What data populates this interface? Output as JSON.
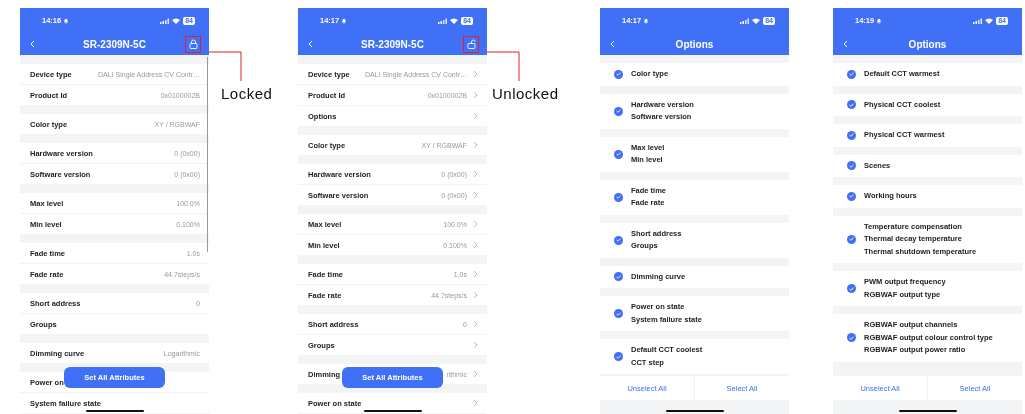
{
  "screens": [
    {
      "kind": "details",
      "time": "14:16",
      "battery": "84",
      "title": "SR-2309N-5C",
      "locked": true,
      "editable": false,
      "scrolling": true,
      "callout": "Locked",
      "sections": [
        [
          {
            "label": "Device type",
            "value": "DALI Single Address CV Contr…"
          },
          {
            "label": "Product Id",
            "value": "0x0100002B"
          }
        ],
        [
          {
            "label": "Color type",
            "value": "XY / RGBWAF"
          }
        ],
        [
          {
            "label": "Hardware version",
            "value": "0 (0x00)"
          },
          {
            "label": "Software version",
            "value": "0 (0x00)"
          }
        ],
        [
          {
            "label": "Max level",
            "value": "100.0%"
          },
          {
            "label": "Min level",
            "value": "0.100%"
          }
        ],
        [
          {
            "label": "Fade time",
            "value": "1.0s"
          },
          {
            "label": "Fade rate",
            "value": "44.7steps/s"
          }
        ],
        [
          {
            "label": "Short address",
            "value": "0"
          },
          {
            "label": "Groups"
          }
        ],
        [
          {
            "label": "Dimming curve",
            "value": "Logarithmic"
          }
        ],
        [
          {
            "label": "Power on"
          },
          {
            "label": "System failure state"
          }
        ]
      ],
      "action_button": "Set All Attributes"
    },
    {
      "kind": "details",
      "time": "14:17",
      "battery": "84",
      "title": "SR-2309N-5C",
      "locked": false,
      "editable": true,
      "scrolling": false,
      "callout": "Unlocked",
      "sections": [
        [
          {
            "label": "Device type",
            "value": "DALI Single Address CV Contr…"
          },
          {
            "label": "Product Id",
            "value": "0x0100002B"
          },
          {
            "label": "Options"
          }
        ],
        [
          {
            "label": "Color type",
            "value": "XY / RGBWAF"
          }
        ],
        [
          {
            "label": "Hardware version",
            "value": "0 (0x00)"
          },
          {
            "label": "Software version",
            "value": "0 (0x00)"
          }
        ],
        [
          {
            "label": "Max level",
            "value": "100.0%"
          },
          {
            "label": "Min level",
            "value": "0.100%"
          }
        ],
        [
          {
            "label": "Fade time",
            "value": "1.0s"
          },
          {
            "label": "Fade rate",
            "value": "44.7steps/s"
          }
        ],
        [
          {
            "label": "Short address",
            "value": "0"
          },
          {
            "label": "Groups"
          }
        ],
        [
          {
            "label": "Dimming",
            "value": "rithmic"
          }
        ],
        [
          {
            "label": "Power on state"
          }
        ]
      ],
      "action_button": "Set All Attributes"
    },
    {
      "kind": "options",
      "time": "14:17",
      "battery": "84",
      "title": "Options",
      "groups": [
        {
          "checked": true,
          "lines": [
            "Color type"
          ]
        },
        {
          "checked": true,
          "lines": [
            "Hardware version",
            "Software version"
          ]
        },
        {
          "checked": true,
          "lines": [
            "Max level",
            "Min level"
          ]
        },
        {
          "checked": true,
          "lines": [
            "Fade time",
            "Fade rate"
          ]
        },
        {
          "checked": true,
          "lines": [
            "Short address",
            "Groups"
          ]
        },
        {
          "checked": true,
          "lines": [
            "Dimming curve"
          ]
        },
        {
          "checked": true,
          "lines": [
            "Power on state",
            "System failure state"
          ]
        },
        {
          "checked": true,
          "lines": [
            "Default CCT coolest",
            "CCT step"
          ]
        }
      ],
      "footer": [
        "Unselect All",
        "Select All"
      ]
    },
    {
      "kind": "options",
      "time": "14:19",
      "battery": "84",
      "title": "Options",
      "groups": [
        {
          "checked": true,
          "lines": [
            "Default CCT warmest"
          ]
        },
        {
          "checked": true,
          "lines": [
            "Physical CCT coolest"
          ]
        },
        {
          "checked": true,
          "lines": [
            "Physical CCT warmest"
          ]
        },
        {
          "checked": true,
          "lines": [
            "Scenes"
          ]
        },
        {
          "checked": true,
          "lines": [
            "Working hours"
          ]
        },
        {
          "checked": true,
          "lines": [
            "Temperature compensation",
            "Thermal decay temperature",
            "Thermal shutdown temperature"
          ]
        },
        {
          "checked": true,
          "lines": [
            "PWM output frequency",
            "RGBWAF output type"
          ]
        },
        {
          "checked": true,
          "lines": [
            "RGBWAF output channels",
            "RGBWAF output colour control type",
            "RGBWAF output power ratio"
          ]
        }
      ],
      "footer": [
        "Unselect All",
        "Select All"
      ]
    }
  ]
}
